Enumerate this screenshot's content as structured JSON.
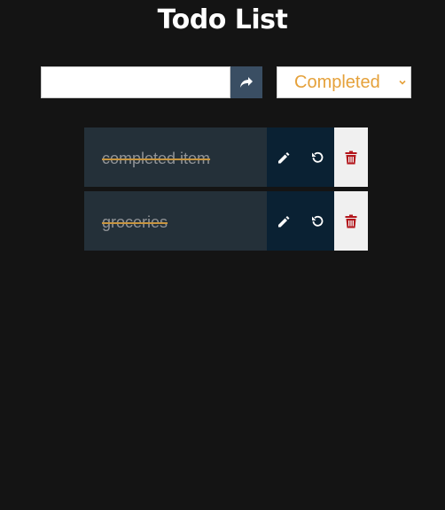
{
  "app": {
    "title": "Todo List"
  },
  "input": {
    "value": "",
    "placeholder": ""
  },
  "add_button": {
    "icon": "share-arrow-icon"
  },
  "filter": {
    "selected": "Completed"
  },
  "colors": {
    "background": "#141414",
    "accent": "#e5a13a",
    "item_bg": "#243039",
    "action_bg": "#0a2133",
    "delete_color": "#b3161c"
  },
  "todos": [
    {
      "text": "completed item",
      "completed": true
    },
    {
      "text": "groceries",
      "completed": true
    }
  ]
}
